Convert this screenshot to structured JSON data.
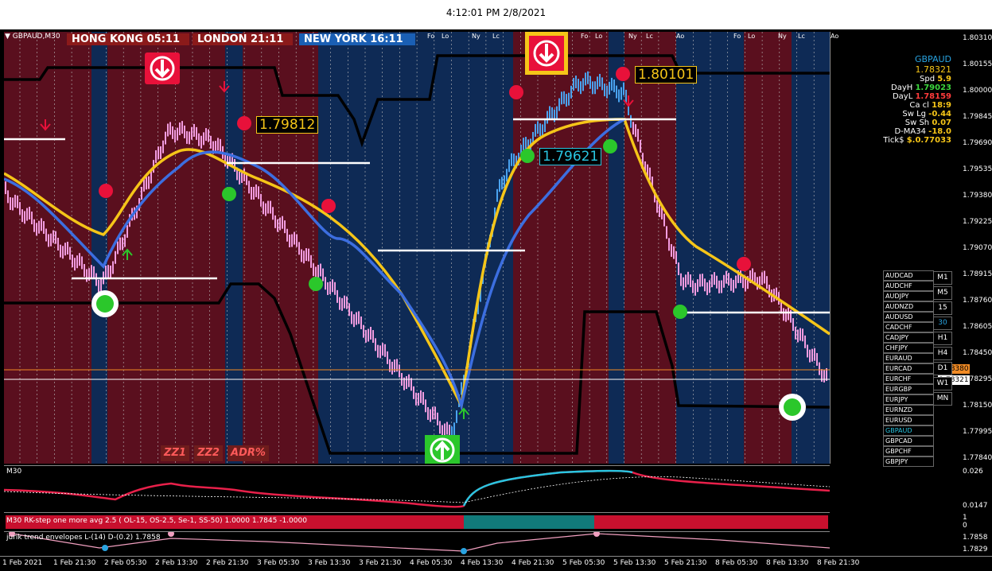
{
  "window": {
    "clock": "4:12:01 PM 2/8/2021"
  },
  "chart": {
    "symbol_tf": "GBPAUD,M30",
    "sessions": [
      {
        "label": "HONG KONG 05:11",
        "color": "#8b1a1a"
      },
      {
        "label": "LONDON  21:11",
        "color": "#8b1a1a"
      },
      {
        "label": "NEW YORK  16:11",
        "color": "#1a5fb4"
      }
    ],
    "session_marks": [
      "Fo",
      "Lo",
      "Ny",
      "Lc",
      "Fo",
      "Lo",
      "Ny",
      "Lc",
      "Ao",
      "Fo",
      "Lo",
      "Ny",
      "Lc",
      "Ao"
    ],
    "price_labels": [
      "1.80310",
      "1.80155",
      "1.80000",
      "1.79845",
      "1.79690",
      "1.79535",
      "1.79380",
      "1.79225",
      "1.79070",
      "1.78915",
      "1.78760",
      "1.78605",
      "1.78450",
      "1.78295",
      "1.78150",
      "1.77995",
      "1.77840"
    ],
    "current_price_tag": "1.78321",
    "orange_price_tag": "1.78380",
    "level_labels": {
      "a": "1.79812",
      "b": "1.79621",
      "c": "1.80101"
    },
    "zz_buttons": [
      "ZZ1",
      "ZZ2",
      "ADR%"
    ]
  },
  "info_panel": {
    "symbol": "GBPAUD",
    "price": "1.78321",
    "rows": [
      {
        "label": "Spd",
        "value": "5.9",
        "color": "#f5c518"
      },
      {
        "label": "DayH",
        "value": "1.79023",
        "color": "#3cd63c"
      },
      {
        "label": "DayL",
        "value": "1.78159",
        "color": "#ff3b3b"
      },
      {
        "label": "Ca cl",
        "value": "18:9",
        "color": "#f5c518"
      },
      {
        "label": "Sw Lg",
        "value": "-0.44",
        "color": "#f5c518"
      },
      {
        "label": "Sw Sh",
        "value": "0.07",
        "color": "#f5c518"
      },
      {
        "label": "D-MA34",
        "value": "-18.0",
        "color": "#f5c518"
      },
      {
        "label": "Tick$",
        "value": "$.0.77033",
        "color": "#f5c518"
      }
    ]
  },
  "pairs": [
    "AUDCAD",
    "AUDCHF",
    "AUDJPY",
    "AUDNZD",
    "AUDUSD",
    "CADCHF",
    "CADJPY",
    "CHFJPY",
    "EURAUD",
    "EURCAD",
    "EURCHF",
    "EURGBP",
    "EURJPY",
    "EURNZD",
    "EURUSD",
    "GBPAUD",
    "GBPCAD",
    "GBPCHF",
    "GBPJPY"
  ],
  "active_pair": "GBPAUD",
  "timeframes": [
    "M1",
    "M5",
    "15",
    "30",
    "H1",
    "H4",
    "D1",
    "W1",
    "MN"
  ],
  "active_timeframe": "30",
  "indicator1": {
    "title": "M30",
    "axis": [
      "0.026",
      "0.0147"
    ]
  },
  "indicator2": {
    "title": "M30 RK-step one more avg 2.5 ( OL-15, OS-2.5, Se-1, SS-50) 1.0000 1.7845 -1.0000",
    "axis": [
      "1",
      "0"
    ]
  },
  "indicator3": {
    "title": "jurik trend envelopes L-(14) D-(0.2) 1.7858",
    "axis": [
      "1.7858",
      "1.7829"
    ]
  },
  "time_axis": [
    "1 Feb 2021",
    "1 Feb 21:30",
    "2 Feb 05:30",
    "2 Feb 13:30",
    "2 Feb 21:30",
    "3 Feb 05:30",
    "3 Feb 13:30",
    "3 Feb 21:30",
    "4 Feb 05:30",
    "4 Feb 13:30",
    "4 Feb 21:30",
    "5 Feb 05:30",
    "5 Feb 13:30",
    "5 Feb 21:30",
    "8 Feb 05:30",
    "8 Feb 13:30",
    "8 Feb 21:30"
  ],
  "colors": {
    "bull_bg": "#5a0f1e",
    "bear_bg": "#0e2a55",
    "gold_line": "#f5c518",
    "blue_line": "#3c6ee0"
  }
}
